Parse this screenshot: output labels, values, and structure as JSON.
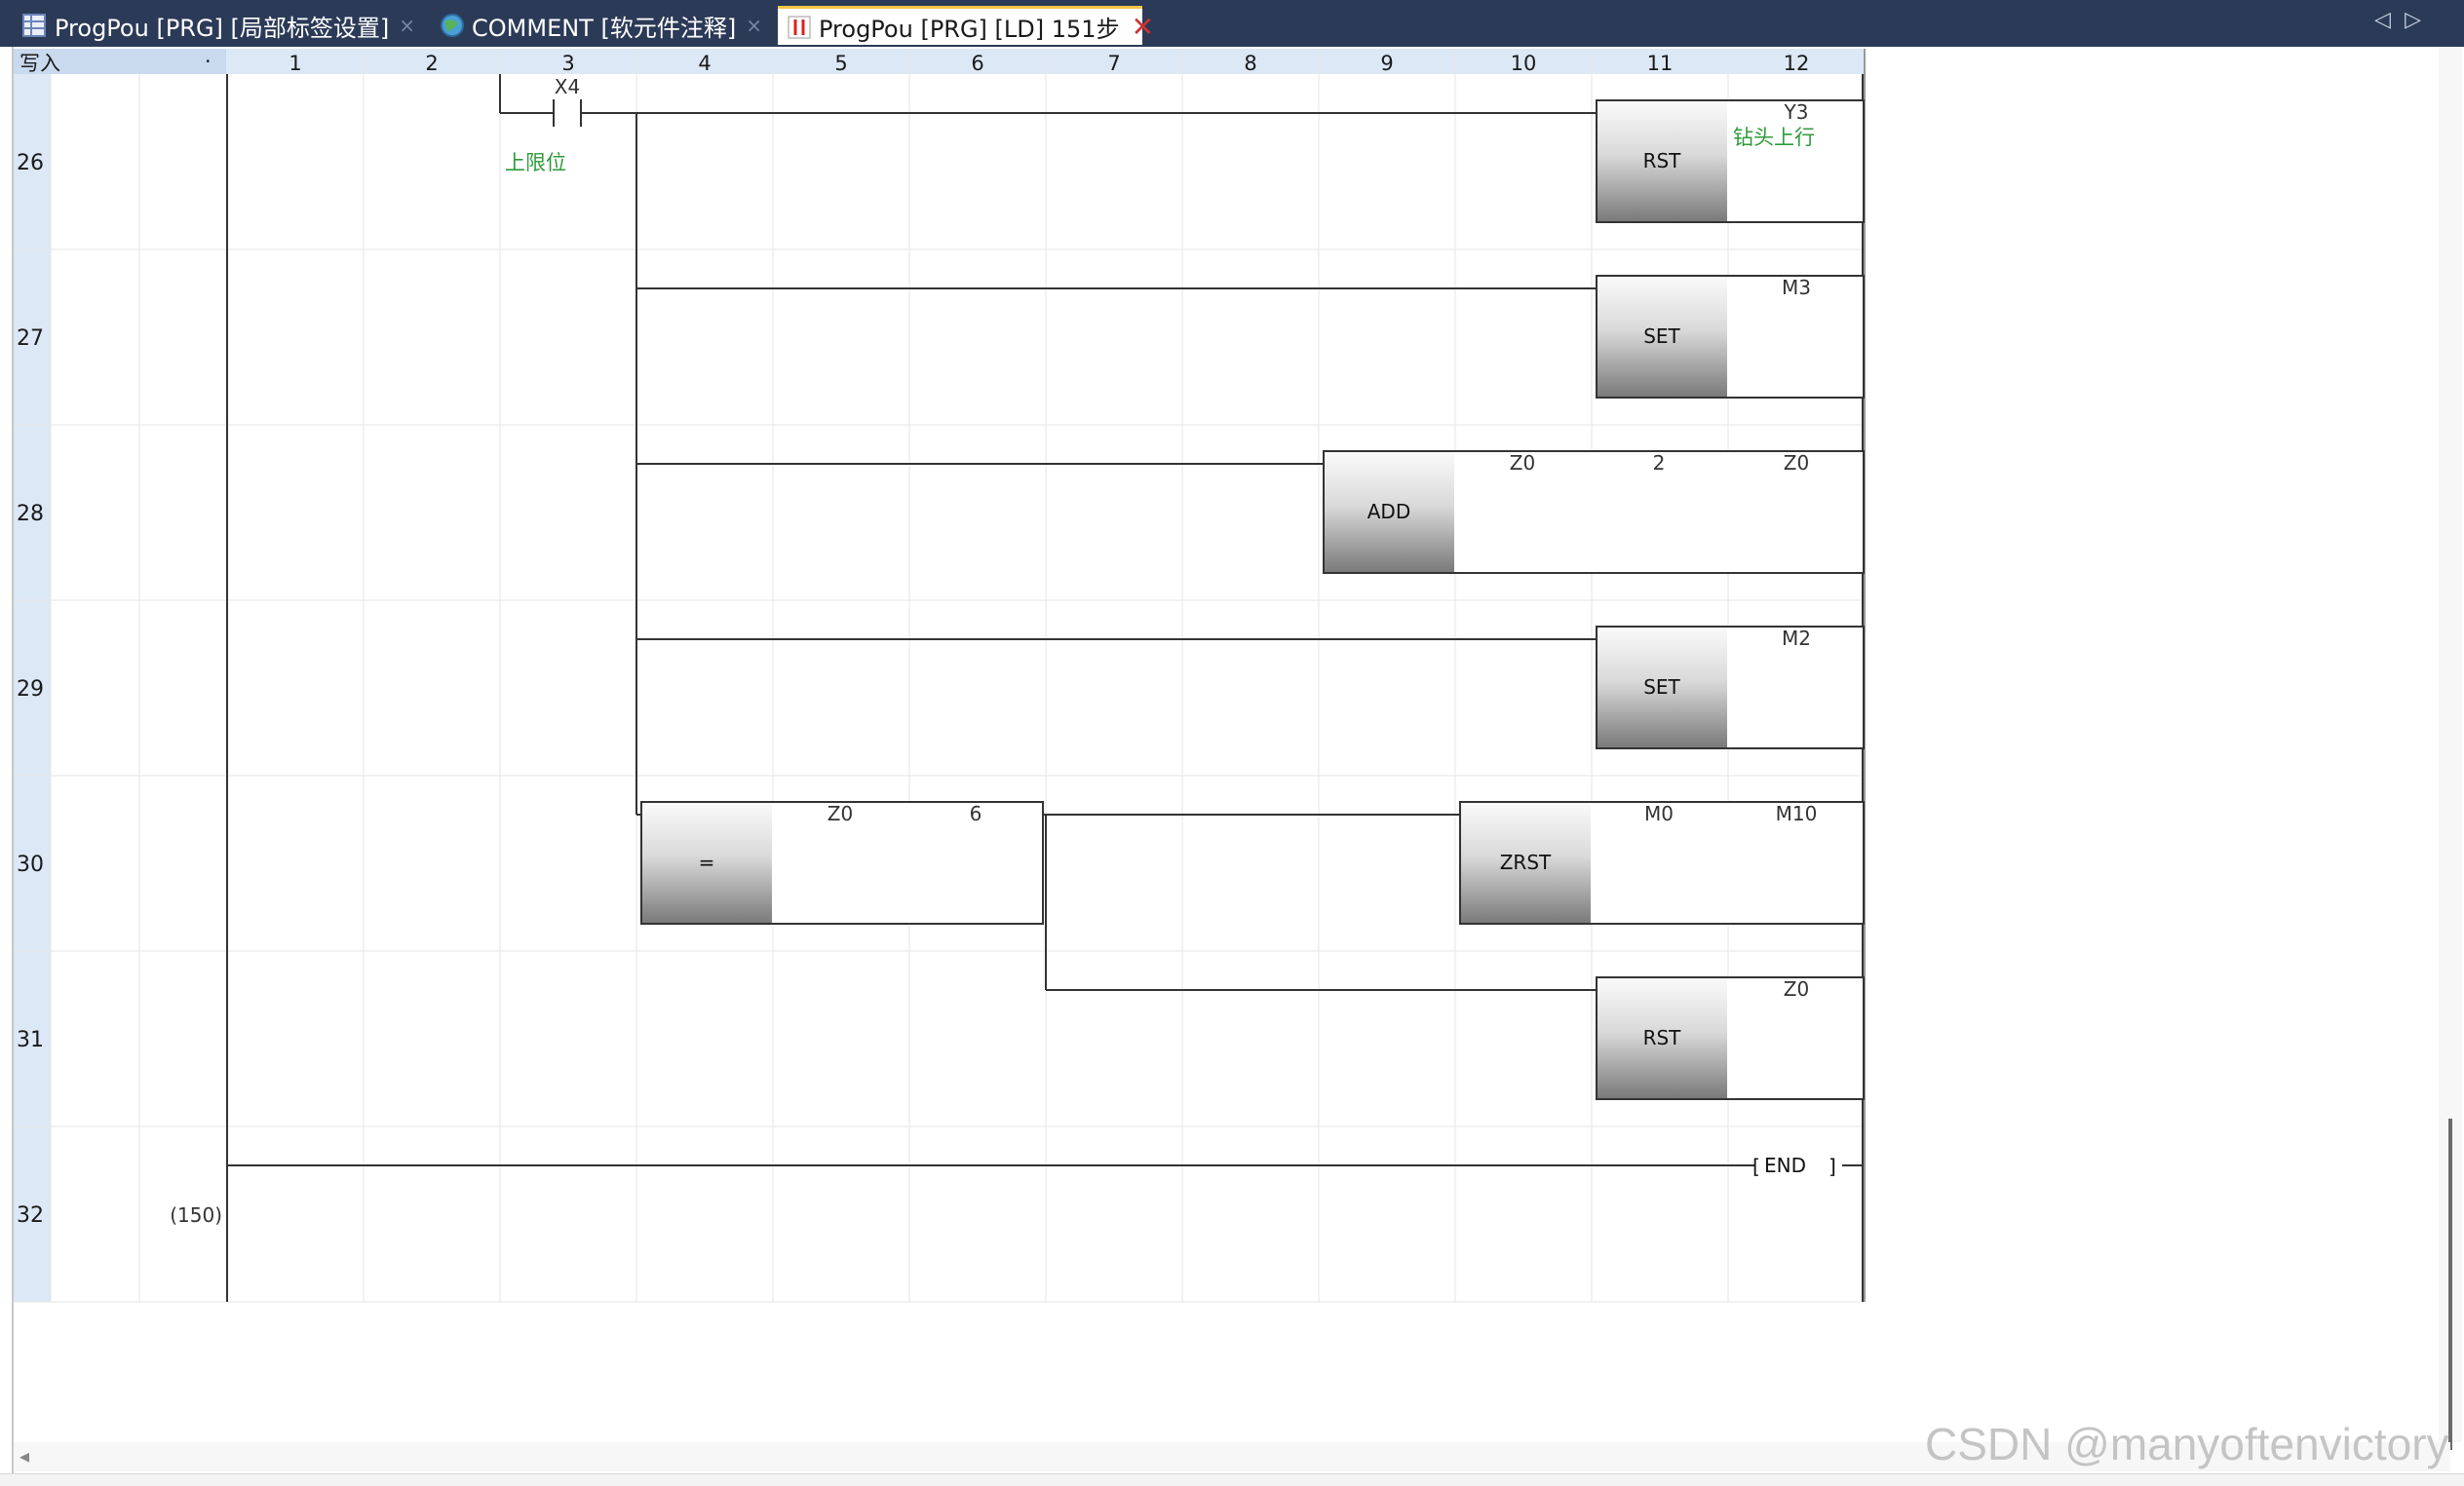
{
  "tabs": [
    {
      "label": "ProgPou [PRG] [局部标签设置]",
      "icon": "table-icon",
      "active": false
    },
    {
      "label": "COMMENT [软元件注释]",
      "icon": "globe-icon",
      "active": false
    },
    {
      "label": "ProgPou [PRG] [LD] 151步",
      "icon": "ladder-icon",
      "active": true
    }
  ],
  "corner_label": "写入",
  "columns": [
    "1",
    "2",
    "3",
    "4",
    "5",
    "6",
    "7",
    "8",
    "9",
    "10",
    "11",
    "12"
  ],
  "rows": [
    {
      "num": "26",
      "step": ""
    },
    {
      "num": "27",
      "step": ""
    },
    {
      "num": "28",
      "step": ""
    },
    {
      "num": "29",
      "step": ""
    },
    {
      "num": "30",
      "step": ""
    },
    {
      "num": "31",
      "step": ""
    },
    {
      "num": "32",
      "step": "(150)"
    }
  ],
  "rungs": {
    "contact_device": "X4",
    "contact_comment": "上限位",
    "rst1": {
      "instr": "RST",
      "operand": "Y3",
      "comment": "钻头上行"
    },
    "set1": {
      "instr": "SET",
      "operand": "M3"
    },
    "add": {
      "instr": "ADD",
      "op1": "Z0",
      "op2": "2",
      "op3": "Z0"
    },
    "set2": {
      "instr": "SET",
      "operand": "M2"
    },
    "cmp": {
      "instr": "=",
      "op1": "Z0",
      "op2": "6"
    },
    "zrst": {
      "instr": "ZRST",
      "op1": "M0",
      "op2": "M10"
    },
    "rst2": {
      "instr": "RST",
      "operand": "Z0"
    },
    "end": "END"
  },
  "watermark": "CSDN @manyoftenvictory",
  "colors": {
    "tabbar": "#2b3a57",
    "header": "#dce8f6",
    "comment": "#2e9a3a",
    "grid": "#e6e6e6"
  }
}
